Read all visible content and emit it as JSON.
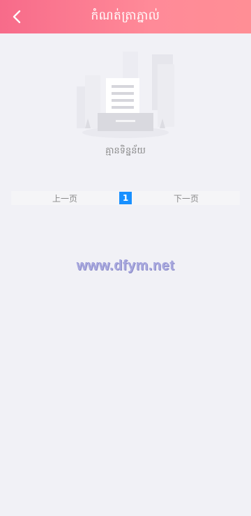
{
  "header": {
    "title": "កំណត់ត្រាភ្នាល់",
    "back_icon": "chevron-left-icon",
    "gradient": [
      "#f76b8a",
      "#ff8e95"
    ]
  },
  "empty_state": {
    "illustration": "empty-document-illustration",
    "message": "គ្មានទិន្នន័យ"
  },
  "pagination": {
    "prev_label": "上一页",
    "current_page": "1",
    "next_label": "下一页",
    "active_color": "#1890ff"
  },
  "watermark": {
    "text": "www.dfym.net"
  }
}
